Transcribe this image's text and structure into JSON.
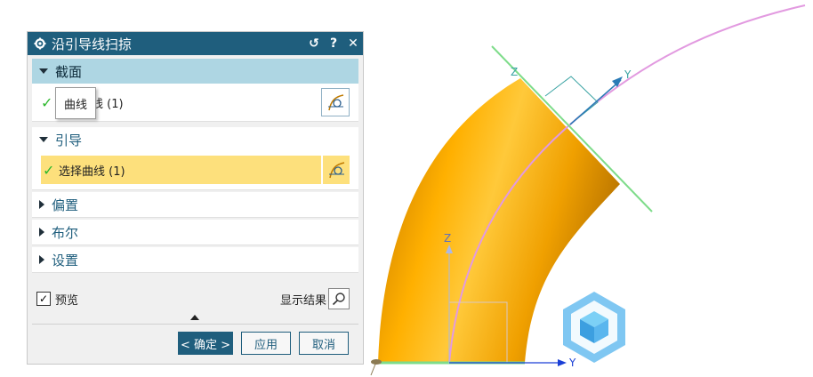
{
  "dialog": {
    "title": "沿引导线扫掠",
    "reset_symbol": "↺",
    "help_symbol": "?",
    "close_symbol": "✕",
    "section_face": {
      "label": "截面",
      "tooltip": "曲线",
      "select_label": "选择曲线 (1)"
    },
    "section_guide": {
      "label": "引导",
      "select_label": "选择曲线 (1)"
    },
    "section_offset": {
      "label": "偏置"
    },
    "section_boolean": {
      "label": "布尔"
    },
    "section_settings": {
      "label": "设置"
    },
    "preview_label": "预览",
    "preview_checked": "✓",
    "show_result_label": "显示结果",
    "ok_label": "< 确定 >",
    "apply_label": "应用",
    "cancel_label": "取消"
  },
  "viewport": {
    "axis_z": "Z",
    "axis_y": "Y",
    "colors": {
      "pipe": "#f5a100",
      "guide": "#e29ae0",
      "section": "#7edc8a",
      "axis": "#1a3fd6",
      "csys": "#3aa3a3"
    }
  }
}
